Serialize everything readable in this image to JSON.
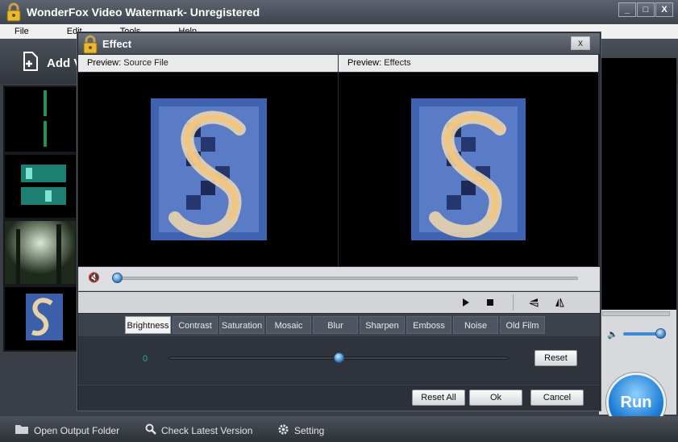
{
  "app": {
    "title": "WonderFox Video Watermark- Unregistered",
    "window_buttons": {
      "minimize": "_",
      "maximize": "□",
      "close": "X"
    }
  },
  "menu": {
    "items": [
      "File",
      "Edit",
      "Tools",
      "Help"
    ]
  },
  "toolbar": {
    "add_video_label": "Add V"
  },
  "statusbar": {
    "open_output_folder": "Open Output Folder",
    "check_latest_version": "Check Latest Version",
    "setting": "Setting"
  },
  "run_button": {
    "label": "Run"
  },
  "dialog": {
    "title": "Effect",
    "close_label": "x",
    "preview_source": {
      "prefix": "Preview:",
      "name": "Source File"
    },
    "preview_effects": {
      "prefix": "Preview:",
      "name": "Effects"
    },
    "tabs": [
      "Brightness",
      "Contrast",
      "Saturation",
      "Mosaic",
      "Blur",
      "Sharpen",
      "Emboss",
      "Noise",
      "Old Film"
    ],
    "active_tab": "Brightness",
    "brightness_value": "0",
    "brightness_level": 0.5,
    "playback_position": 0.0,
    "reset_label": "Reset",
    "reset_all_label": "Reset All",
    "ok_label": "Ok",
    "cancel_label": "Cancel"
  },
  "colors": {
    "dark_bg": "#2c3139",
    "accent_blue": "#1f7fd6",
    "value_teal": "#2aa7a7"
  }
}
